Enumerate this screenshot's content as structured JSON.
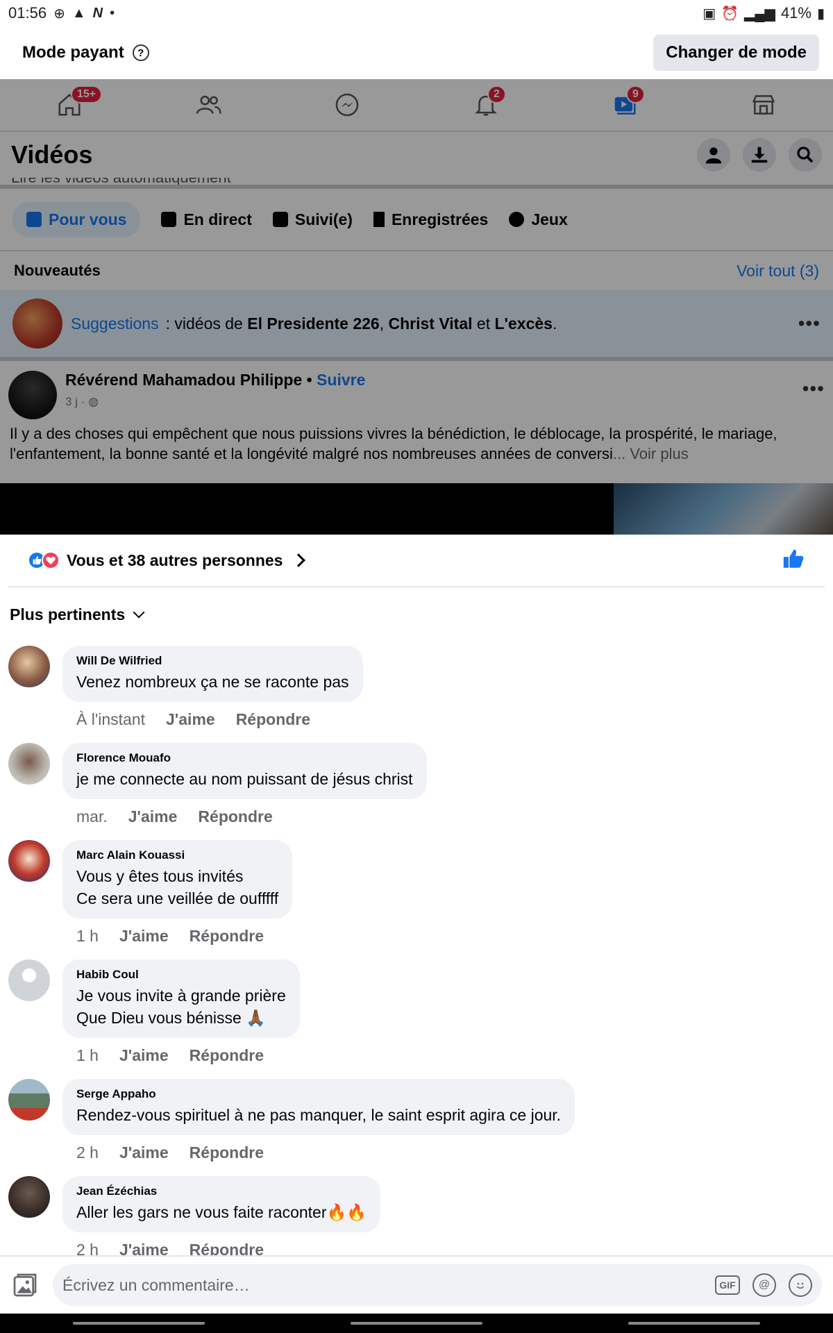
{
  "status": {
    "time": "01:56",
    "battery": "41%"
  },
  "modebar": {
    "title": "Mode payant",
    "button": "Changer de mode"
  },
  "nav": {
    "badges": {
      "home": "15+",
      "notifications": "2",
      "videos": "9"
    }
  },
  "videos": {
    "title": "Vidéos",
    "autoplay_text": "Lire les vidéos automatiquement"
  },
  "chips": [
    "Pour vous",
    "En direct",
    "Suivi(e)",
    "Enregistrées",
    "Jeux"
  ],
  "nouveautes": {
    "title": "Nouveautés",
    "link": "Voir tout (3)"
  },
  "suggestions": {
    "label": "Suggestions",
    "text_pre": " : vidéos de ",
    "name1": "El Presidente 226",
    "sep1": ", ",
    "name2": "Christ Vital",
    "sep2": " et ",
    "name3": "L'excès",
    "end": "."
  },
  "post": {
    "author": "Révérend Mahamadou Philippe",
    "dot": "•",
    "follow": "Suivre",
    "time": "3 j ·",
    "text": "Il y a des choses qui empêchent que nous puissions vivres la bénédiction, le déblocage, la prospérité, le mariage, l'enfantement, la bonne santé et la longévité malgré nos nombreuses années de conversi",
    "more": "... Voir plus"
  },
  "reactions": {
    "text": "Vous et 38 autres personnes"
  },
  "sort": {
    "label": "Plus pertinents"
  },
  "comments": [
    {
      "name": "Will De Wilfried",
      "lines": [
        "Venez nombreux ça ne se raconte pas"
      ],
      "time": "À l'instant",
      "like": "J'aime",
      "reply": "Répondre",
      "avatar": "#8a5a44"
    },
    {
      "name": "Florence Mouafo",
      "lines": [
        "je me connecte au nom puissant de jésus christ"
      ],
      "time": "mar.",
      "like": "J'aime",
      "reply": "Répondre",
      "avatar": "#b9b4ad"
    },
    {
      "name": "Marc Alain Kouassi",
      "lines": [
        "Vous y êtes tous invités",
        "Ce sera une veillée de oufffff"
      ],
      "time": "1 h",
      "like": "J'aime",
      "reply": "Répondre",
      "avatar": "#c0392b"
    },
    {
      "name": "Habib Coul",
      "lines": [
        "Je vous invite à grande prière",
        "Que Dieu vous bénisse 🙏🏾"
      ],
      "time": "1 h",
      "like": "J'aime",
      "reply": "Répondre",
      "avatar": "#d0d3d8"
    },
    {
      "name": "Serge Appaho",
      "lines": [
        "Rendez-vous spirituel à ne pas manquer, le saint esprit agira ce jour."
      ],
      "time": "2 h",
      "like": "J'aime",
      "reply": "Répondre",
      "avatar": "#5d7b63"
    },
    {
      "name": "Jean Ézéchias",
      "lines": [
        "Aller les gars ne vous faite raconter🔥🔥"
      ],
      "time": "2 h",
      "like": "J'aime",
      "reply": "Répondre",
      "avatar": "#3b2f2a"
    }
  ],
  "composer": {
    "placeholder": "Écrivez un commentaire…",
    "gif": "GIF",
    "at": "@"
  },
  "colors": {
    "accent": "#1877f2",
    "badge": "#e41e3f",
    "bubble": "#f0f2f5"
  },
  "icons": [
    "home-icon",
    "friends-icon",
    "messenger-icon",
    "bell-icon",
    "video-icon",
    "marketplace-icon",
    "profile-icon",
    "download-icon",
    "search-icon",
    "thumbs-up-icon",
    "photo-icon",
    "gif-icon",
    "at-icon",
    "emoji-icon"
  ]
}
